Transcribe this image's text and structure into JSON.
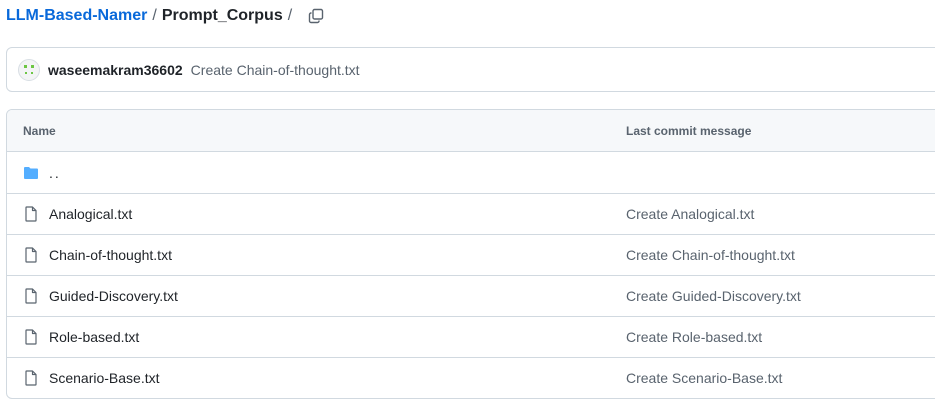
{
  "breadcrumb": {
    "repo": "LLM-Based-Namer",
    "separator": "/",
    "folder": "Prompt_Corpus",
    "trailing_separator": "/"
  },
  "commit": {
    "user": "waseemakram36602",
    "message": "Create Chain-of-thought.txt"
  },
  "table": {
    "headers": {
      "name": "Name",
      "last_commit": "Last commit message"
    },
    "parent_dir": "..",
    "files": [
      {
        "name": "Analogical.txt",
        "message": "Create Analogical.txt"
      },
      {
        "name": "Chain-of-thought.txt",
        "message": "Create Chain-of-thought.txt"
      },
      {
        "name": "Guided-Discovery.txt",
        "message": "Create Guided-Discovery.txt"
      },
      {
        "name": "Role-based.txt",
        "message": "Create Role-based.txt"
      },
      {
        "name": "Scenario-Base.txt",
        "message": "Create Scenario-Base.txt"
      }
    ]
  },
  "icons": {
    "copy": "copy-icon",
    "folder": "folder-icon",
    "file": "file-icon",
    "avatar": "avatar-identicon"
  },
  "colors": {
    "link": "#0969da",
    "folder": "#54aeff",
    "muted": "#59636e",
    "border": "#d1d9e0",
    "avatar_green": "#6cc644"
  }
}
